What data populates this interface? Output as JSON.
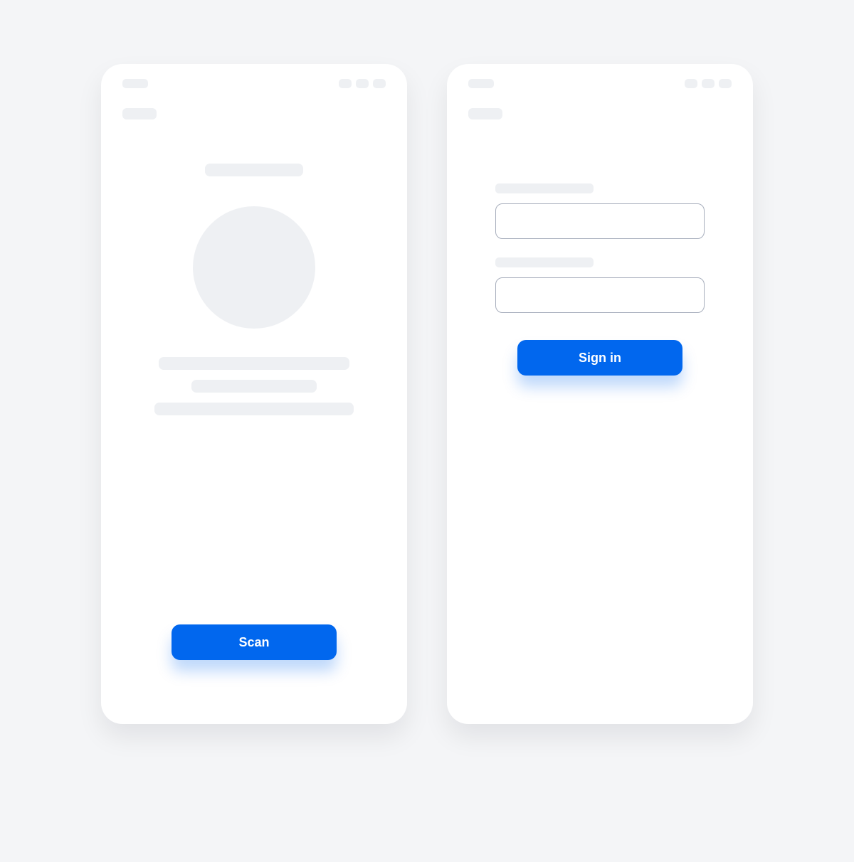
{
  "screens": {
    "scan": {
      "button_label": "Scan"
    },
    "signin": {
      "button_label": "Sign in",
      "field1": {
        "placeholder": ""
      },
      "field2": {
        "placeholder": ""
      }
    }
  }
}
